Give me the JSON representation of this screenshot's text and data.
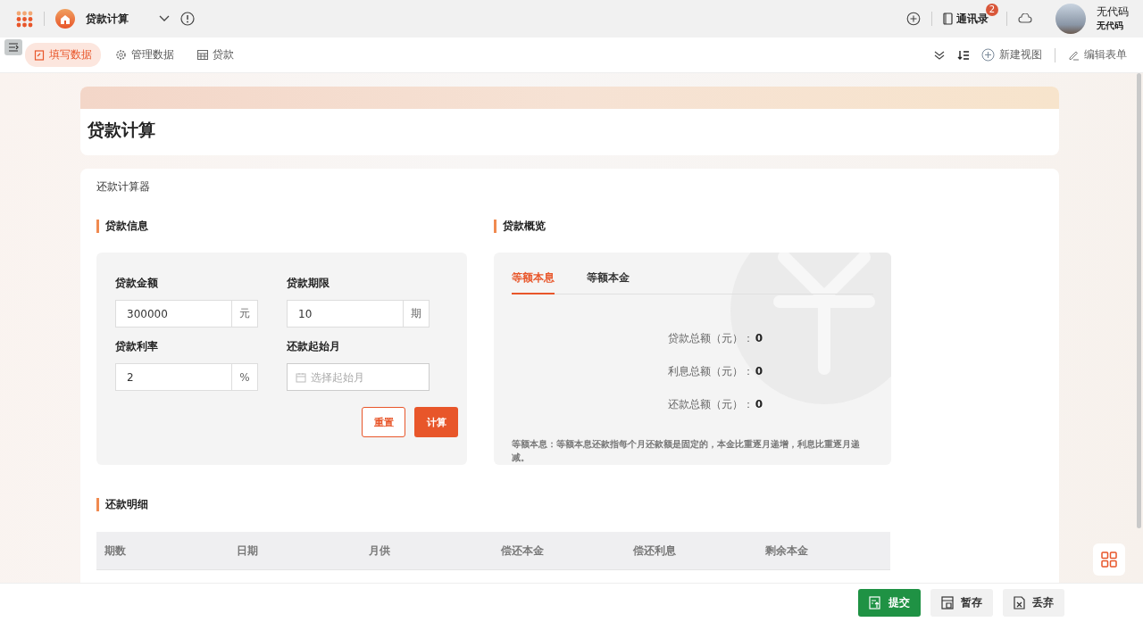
{
  "app_bar": {
    "title": "贷款计算",
    "contacts": {
      "label": "通讯录",
      "badge": "2"
    },
    "user": {
      "name": "无代码",
      "org": "无代码"
    }
  },
  "nav_tabs": [
    {
      "label": "填写数据",
      "selected": true
    },
    {
      "label": "管理数据",
      "selected": false
    },
    {
      "label": "贷款",
      "selected": false
    }
  ],
  "toolbar": {
    "new_view": "新建视图",
    "edit_form": "编辑表单"
  },
  "form_title": "贷款计算",
  "card_title": "还款计算器",
  "loan_info": {
    "title": "贷款信息",
    "fields": [
      {
        "label": "贷款金额",
        "kind": "unit",
        "value": "300000",
        "unit": "元"
      },
      {
        "label": "贷款期限",
        "kind": "unit",
        "value": "10",
        "unit": "期"
      },
      {
        "label": "贷款利率",
        "kind": "unit",
        "value": "2",
        "unit": "%"
      },
      {
        "label": "还款起始月",
        "kind": "date",
        "placeholder": "选择起始月"
      }
    ],
    "buttons": [
      {
        "label": "重置",
        "kind": "secondary"
      },
      {
        "label": "计算",
        "kind": "primary"
      }
    ]
  },
  "overview": {
    "title": "贷款概览",
    "tabs": [
      {
        "label": "等额本息",
        "selected": true
      },
      {
        "label": "等额本金",
        "selected": false
      }
    ],
    "totals": [
      {
        "label": "贷款总额（元）：",
        "value": "0"
      },
      {
        "label": "利息总额（元）：",
        "value": "0"
      },
      {
        "label": "还款总额（元）：",
        "value": "0"
      }
    ],
    "note": "等额本息：等额本息还款指每个月还款额是固定的，本金比重逐月递增，利息比重逐月递减。"
  },
  "details": {
    "title": "还款明细",
    "columns": [
      "期数",
      "日期",
      "月供",
      "偿还本金",
      "偿还利息",
      "剩余本金"
    ]
  },
  "footer_buttons": [
    {
      "label": "提交",
      "kind": "primary"
    },
    {
      "label": "暂存",
      "kind": "default"
    },
    {
      "label": "丢弃",
      "kind": "default"
    }
  ]
}
